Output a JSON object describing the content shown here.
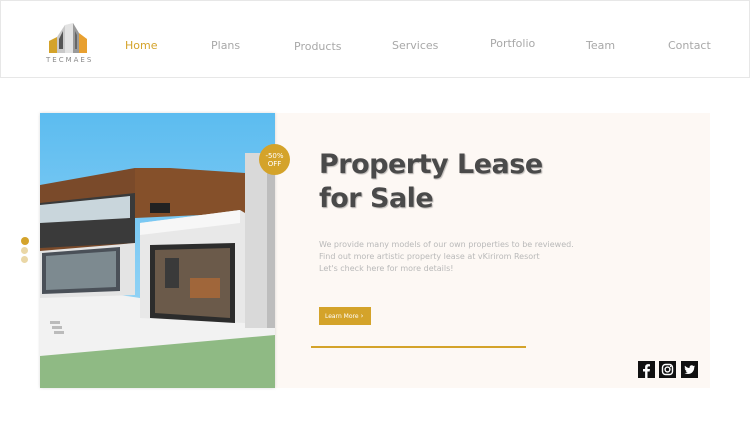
{
  "brand": {
    "logo_text": "TECMAES"
  },
  "nav": {
    "items": [
      {
        "label": "Home",
        "active": true
      },
      {
        "label": "Plans"
      },
      {
        "label": "Products"
      },
      {
        "label": "Services"
      },
      {
        "label": "Portfolio"
      },
      {
        "label": "Team"
      },
      {
        "label": "Contact"
      }
    ]
  },
  "hero": {
    "badge": {
      "line1": "-50%",
      "line2": "OFF"
    },
    "title_line1": "Property Lease",
    "title_line2": "for Sale",
    "description": [
      "We provide many models of our own properties to be reviewed.",
      "Find out more artistic property lease at vKirirom Resort",
      "Let's check here for more details!"
    ],
    "cta_label": "Learn More"
  },
  "social": {
    "icons": [
      "facebook-icon",
      "instagram-icon",
      "twitter-icon"
    ]
  },
  "colors": {
    "accent": "#d4a32a",
    "title": "#4a4a4a",
    "card_bg": "#fdf8f4"
  }
}
